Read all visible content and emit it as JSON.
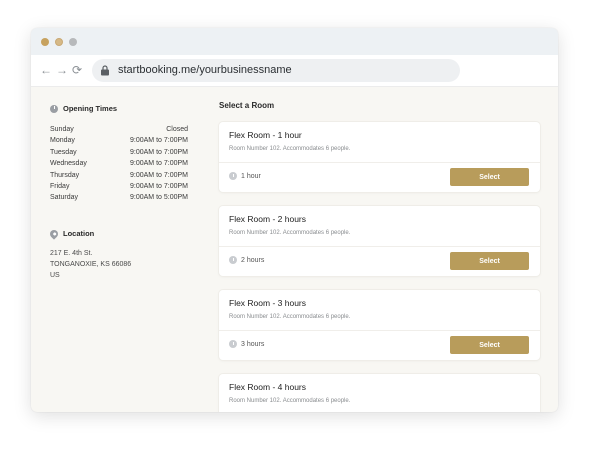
{
  "browser": {
    "url": "startbooking.me/yourbusinessname",
    "back_icon": "←",
    "forward_icon": "→",
    "reload_icon": "⟳"
  },
  "opening_times": {
    "title": "Opening Times",
    "rows": [
      {
        "day": "Sunday",
        "hours": "Closed"
      },
      {
        "day": "Monday",
        "hours": "9:00AM to 7:00PM"
      },
      {
        "day": "Tuesday",
        "hours": "9:00AM to 7:00PM"
      },
      {
        "day": "Wednesday",
        "hours": "9:00AM to 7:00PM"
      },
      {
        "day": "Thursday",
        "hours": "9:00AM to 7:00PM"
      },
      {
        "day": "Friday",
        "hours": "9:00AM to 7:00PM"
      },
      {
        "day": "Saturday",
        "hours": "9:00AM to 5:00PM"
      }
    ]
  },
  "location": {
    "title": "Location",
    "line1": "217 E. 4th St.",
    "line2": "TONGANOXIE, KS 66086",
    "line3": "US"
  },
  "rooms": {
    "title": "Select a Room",
    "items": [
      {
        "name": "Flex Room - 1 hour",
        "desc": "Room Number 102. Accommodates 6 people.",
        "duration": "1 hour",
        "button": "Select"
      },
      {
        "name": "Flex Room - 2 hours",
        "desc": "Room Number 102. Accommodates 6 people.",
        "duration": "2 hours",
        "button": "Select"
      },
      {
        "name": "Flex Room - 3 hours",
        "desc": "Room Number 102. Accommodates 6 people.",
        "duration": "3 hours",
        "button": "Select"
      },
      {
        "name": "Flex Room - 4 hours",
        "desc": "Room Number 102. Accommodates 6 people."
      }
    ]
  },
  "colors": {
    "accent": "#b89c5b",
    "background": "#f8f7f3"
  }
}
